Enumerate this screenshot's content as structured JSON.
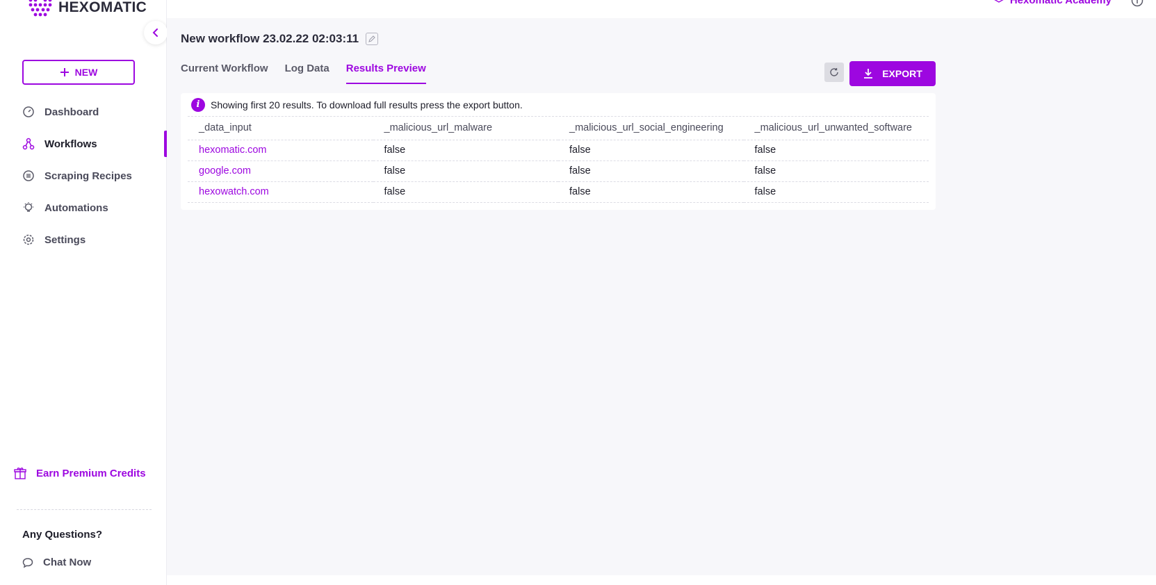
{
  "brand": {
    "name": "HEXOMATIC",
    "accent": "#9d07e0"
  },
  "sidebar": {
    "new_label": "NEW",
    "items": [
      {
        "label": "Dashboard",
        "icon": "dashboard-icon"
      },
      {
        "label": "Workflows",
        "icon": "workflow-icon",
        "active": true
      },
      {
        "label": "Scraping Recipes",
        "icon": "recipes-icon"
      },
      {
        "label": "Automations",
        "icon": "bulb-icon"
      },
      {
        "label": "Settings",
        "icon": "gear-icon"
      }
    ],
    "earn_label": "Earn Premium Credits",
    "questions_label": "Any Questions?",
    "chat_label": "Chat Now"
  },
  "topbar": {
    "academy_label": "Hexomatic Academy"
  },
  "workflow": {
    "title": "New workflow 23.02.22 02:03:11",
    "tabs": [
      {
        "label": "Current Workflow"
      },
      {
        "label": "Log Data"
      },
      {
        "label": "Results Preview",
        "active": true
      }
    ],
    "export_label": "EXPORT",
    "notice": "Showing first 20 results. To download full results press the export button."
  },
  "results": {
    "columns": [
      "_data_input",
      "_malicious_url_malware",
      "_malicious_url_social_engineering",
      "_malicious_url_unwanted_software"
    ],
    "rows": [
      [
        "hexomatic.com",
        "false",
        "false",
        "false"
      ],
      [
        "google.com",
        "false",
        "false",
        "false"
      ],
      [
        "hexowatch.com",
        "false",
        "false",
        "false"
      ]
    ]
  }
}
